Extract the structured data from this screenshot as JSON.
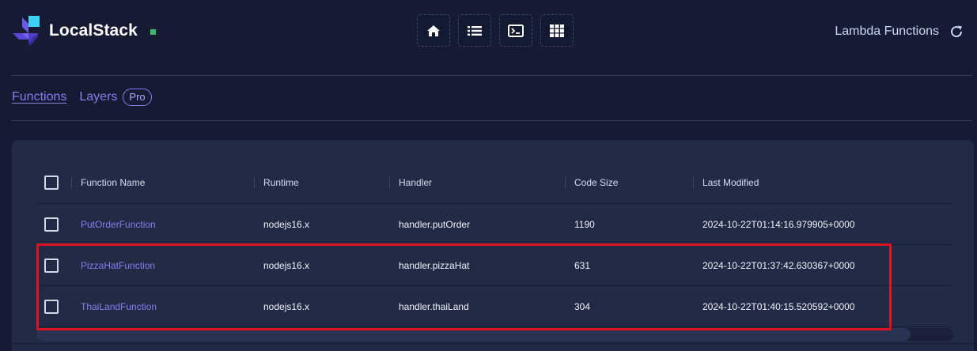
{
  "header": {
    "brand_name": "LocalStack",
    "page_title": "Lambda Functions",
    "status_color": "#3bb86b",
    "toolbar": [
      {
        "icon": "home-icon",
        "name": "home-button"
      },
      {
        "icon": "list-icon",
        "name": "list-button"
      },
      {
        "icon": "terminal-icon",
        "name": "terminal-button"
      },
      {
        "icon": "grid-icon",
        "name": "grid-button"
      }
    ]
  },
  "tabs": {
    "functions": "Functions",
    "layers": "Layers",
    "pro_badge": "Pro"
  },
  "table": {
    "columns": {
      "name": "Function Name",
      "runtime": "Runtime",
      "handler": "Handler",
      "size": "Code Size",
      "modified": "Last Modified"
    },
    "rows": [
      {
        "name": "PutOrderFunction",
        "runtime": "nodejs16.x",
        "handler": "handler.putOrder",
        "size": "1190",
        "modified": "2024-10-22T01:14:16.979905+0000"
      },
      {
        "name": "PizzaHatFunction",
        "runtime": "nodejs16.x",
        "handler": "handler.pizzaHat",
        "size": "631",
        "modified": "2024-10-22T01:37:42.630367+0000"
      },
      {
        "name": "ThaiLandFunction",
        "runtime": "nodejs16.x",
        "handler": "handler.thaiLand",
        "size": "304",
        "modified": "2024-10-22T01:40:15.520592+0000"
      }
    ]
  },
  "colors": {
    "accent": "#8a7cf0",
    "background": "#161b33",
    "panel": "#232a45",
    "highlight": "#e0121f"
  }
}
